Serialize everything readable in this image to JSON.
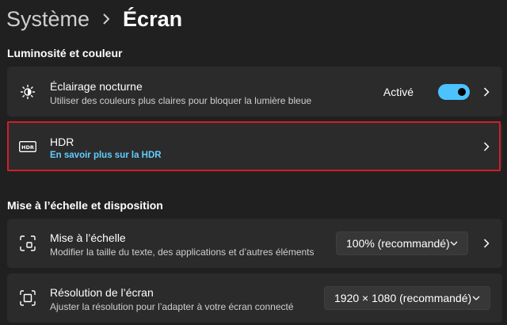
{
  "breadcrumb": {
    "parent": "Système",
    "current": "Écran"
  },
  "sections": {
    "brightness": "Luminosité et couleur",
    "scale": "Mise à l’échelle et disposition"
  },
  "night_light": {
    "title": "Éclairage nocturne",
    "subtitle": "Utiliser des couleurs plus claires pour bloquer la lumière bleue",
    "status": "Activé",
    "toggle_on": true,
    "icon": "brightness-moon-icon"
  },
  "hdr": {
    "title": "HDR",
    "link": "En savoir plus sur la HDR",
    "icon": "hdr-icon"
  },
  "scale": {
    "title": "Mise à l’échelle",
    "subtitle": "Modifier la taille du texte, des applications et d’autres éléments",
    "value": "100% (recommandé)",
    "icon": "scale-icon"
  },
  "resolution": {
    "title": "Résolution de l’écran",
    "subtitle": "Ajuster la résolution pour l’adapter à  votre  écran connecté",
    "value": "1920 × 1080 (recommandé)",
    "icon": "resolution-icon"
  },
  "colors": {
    "accent": "#4cc2ff",
    "link": "#60cdff",
    "highlight": "#d01f2a",
    "card": "#2b2b2b",
    "background": "#202020"
  }
}
